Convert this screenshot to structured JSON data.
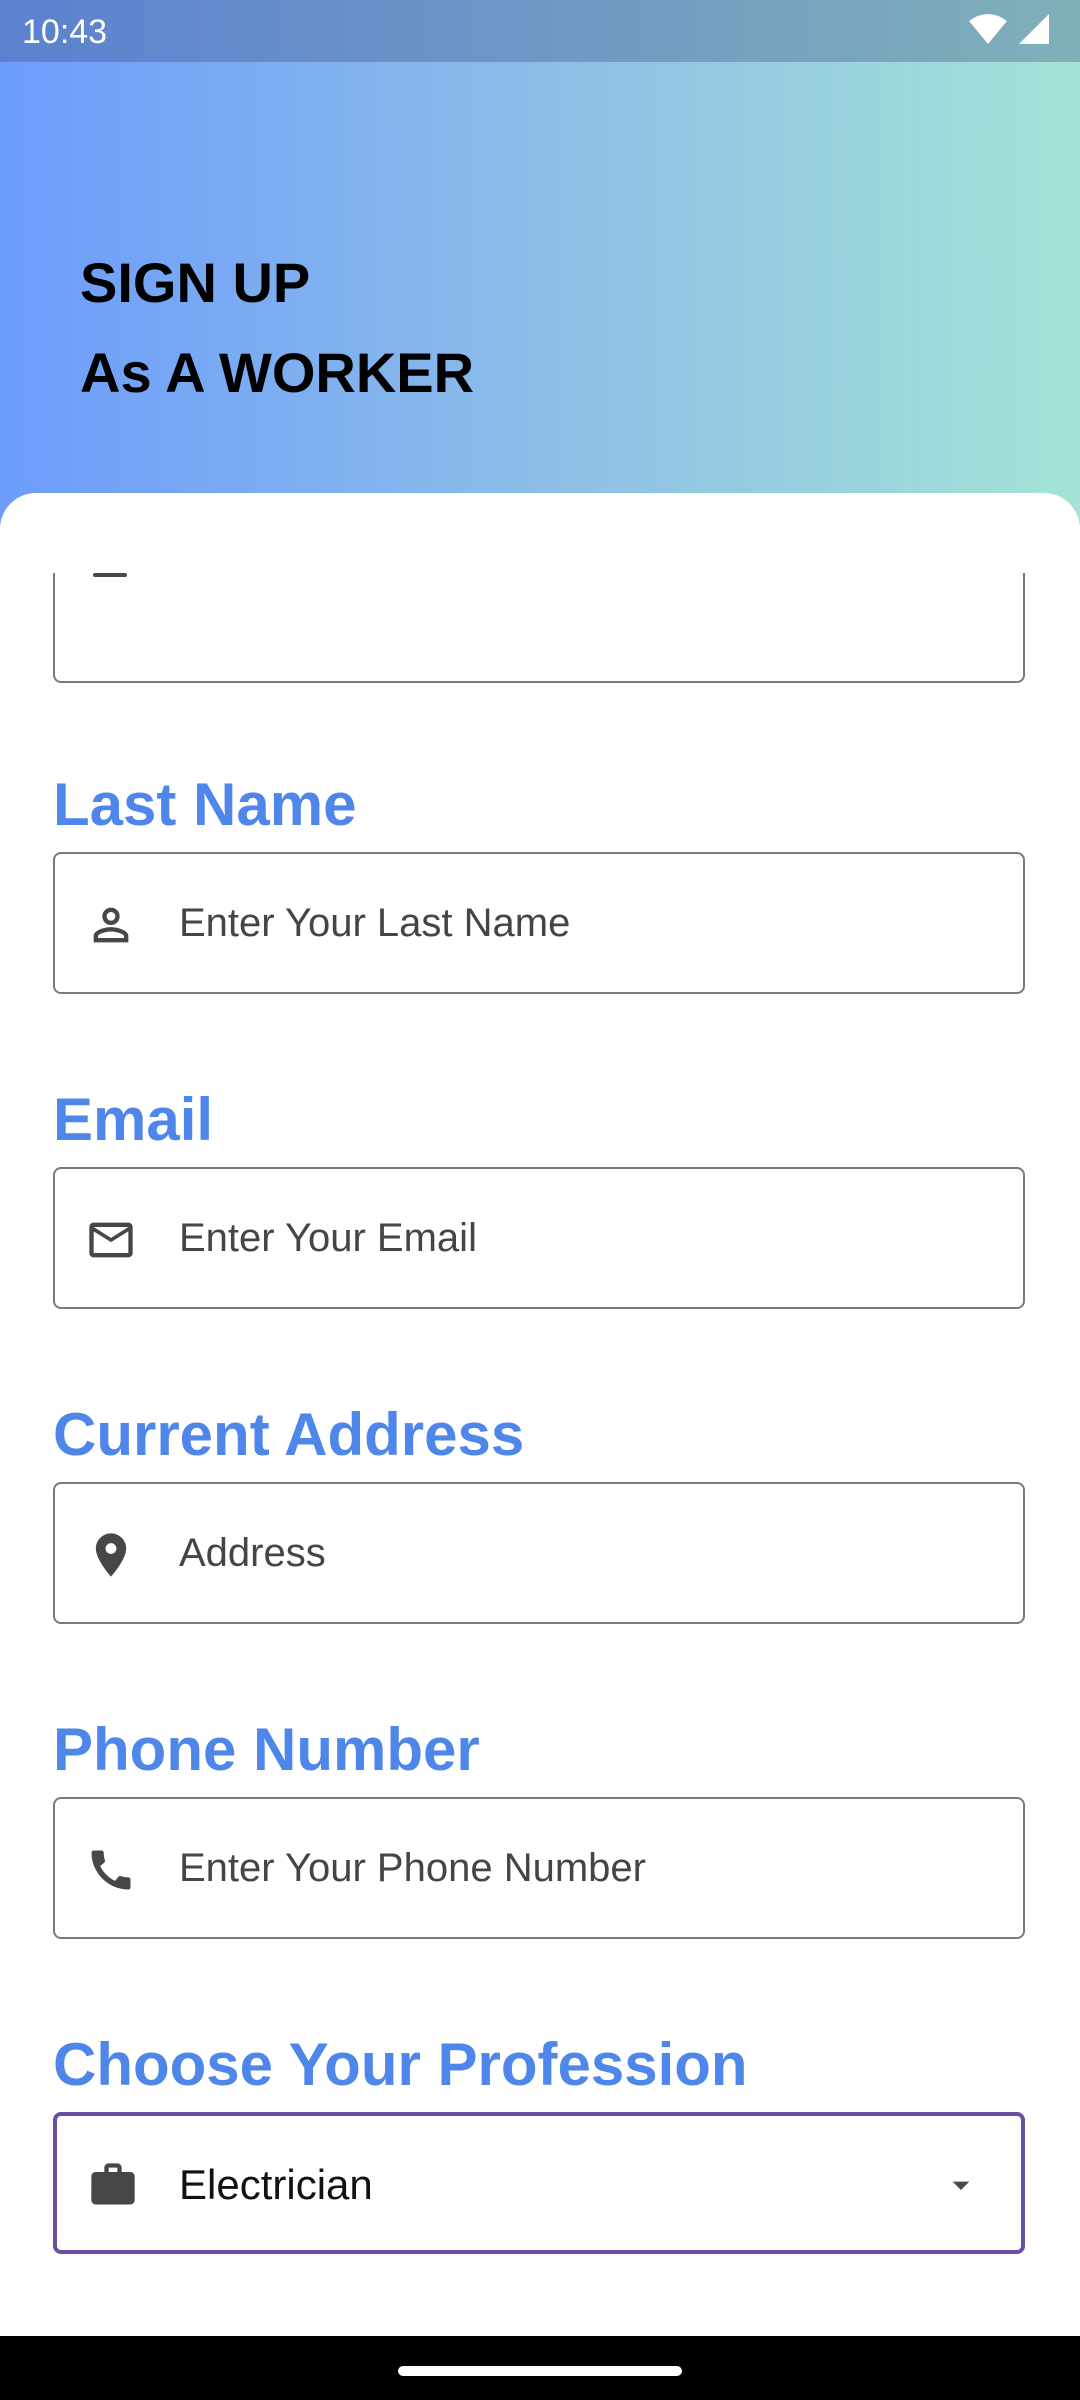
{
  "status_bar": {
    "time": "10:43",
    "icons": [
      "wifi-icon",
      "cellular-signal-icon"
    ]
  },
  "header": {
    "title_line1": "SIGN UP",
    "title_line2": "As A WORKER"
  },
  "colors": {
    "gradient_start": "#6c9cfb",
    "gradient_end": "#a3e4d6",
    "label_color": "#4e86ea",
    "select_border": "#6b4fa0"
  },
  "form": {
    "last_name": {
      "label": "Last Name",
      "placeholder": "Enter Your Last Name",
      "icon": "person-icon"
    },
    "email": {
      "label": "Email",
      "placeholder": "Enter Your Email",
      "icon": "mail-icon"
    },
    "address": {
      "label": "Current Address",
      "placeholder": "Address",
      "icon": "location-pin-icon"
    },
    "phone": {
      "label": "Phone Number",
      "placeholder": "Enter Your Phone Number",
      "icon": "phone-icon"
    },
    "profession": {
      "label": "Choose Your Profession",
      "selected": "Electrician",
      "icon": "briefcase-icon"
    }
  }
}
